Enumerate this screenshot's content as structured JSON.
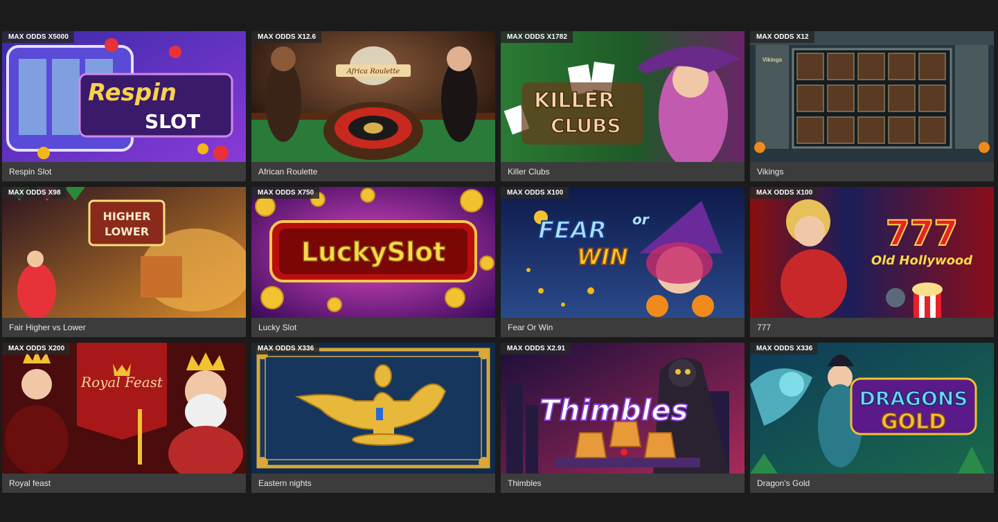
{
  "games": [
    {
      "name": "Respin Slot",
      "odds": "MAX ODDS X5000",
      "art_text": [
        "Respin",
        "SLOT"
      ],
      "colors": [
        "#2b1b7a",
        "#7a3fd1"
      ]
    },
    {
      "name": "African Roulette",
      "odds": "MAX ODDS X12.6",
      "art_text": [
        "Africa Roulette"
      ],
      "colors": [
        "#2a1810",
        "#5a2e1c"
      ]
    },
    {
      "name": "Killer Clubs",
      "odds": "MAX ODDS X1782",
      "art_text": [
        "KILLER",
        "CLUBS"
      ],
      "colors": [
        "#1f5a2a",
        "#7a2a6a"
      ]
    },
    {
      "name": "Vikings",
      "odds": "MAX ODDS X12",
      "art_text": [
        "Vikings"
      ],
      "colors": [
        "#1c2e3a",
        "#2e4a4e"
      ]
    },
    {
      "name": "Fair Higher vs Lower",
      "odds": "MAX ODDS X98",
      "art_text": [
        "HIGHER",
        "LOWER"
      ],
      "colors": [
        "#3a1a1a",
        "#c96a1a"
      ]
    },
    {
      "name": "Lucky Slot",
      "odds": "MAX ODDS X750",
      "art_text": [
        "LuckySlot"
      ],
      "colors": [
        "#5a0f7a",
        "#b82aa0"
      ]
    },
    {
      "name": "Fear Or Win",
      "odds": "MAX ODDS X100",
      "art_text": [
        "FEAR",
        "or",
        "WIN"
      ],
      "colors": [
        "#14205a",
        "#2a4aa0"
      ]
    },
    {
      "name": "777",
      "odds": "MAX ODDS X100",
      "art_text": [
        "777",
        "Old Hollywood"
      ],
      "colors": [
        "#141a4a",
        "#7a1010"
      ]
    },
    {
      "name": "Royal feast",
      "odds": "MAX ODDS X200",
      "art_text": [
        "Royal Feast"
      ],
      "colors": [
        "#5a0e0e",
        "#9a1a1a"
      ]
    },
    {
      "name": "Eastern nights",
      "odds": "MAX ODDS X336",
      "art_text": [],
      "colors": [
        "#0e2442",
        "#1e3a66"
      ]
    },
    {
      "name": "Thimbles",
      "odds": "MAX ODDS X2.91",
      "art_text": [
        "Thimbles"
      ],
      "colors": [
        "#2a1240",
        "#c2306a"
      ]
    },
    {
      "name": "Dragon's Gold",
      "odds": "MAX ODDS X336",
      "art_text": [
        "DRAGONS",
        "GOLD"
      ],
      "colors": [
        "#0e4a5a",
        "#1a7a6a"
      ]
    }
  ]
}
